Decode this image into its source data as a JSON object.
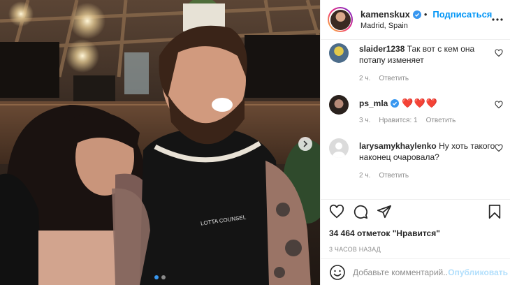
{
  "post": {
    "author": {
      "username": "kamenskux",
      "verified": true,
      "follow_label": "Подписаться",
      "location": "Madrid, Spain",
      "avatar_icon": "profile-avatar"
    },
    "photo": {
      "printed_text": "LOTTA COUNSEL",
      "carousel_dots": 2,
      "active_dot": 0,
      "next_icon": "chevron-right-icon"
    },
    "comments": [
      {
        "username": "slaider1238",
        "verified": false,
        "text": "Так вот с кем она потапу изменяет",
        "time": "2 ч.",
        "reply_label": "Ответить",
        "likes_label": "",
        "avatar_color": "#6d8e4f"
      },
      {
        "username": "ps_mla",
        "verified": true,
        "text": "❤️❤️❤️",
        "time": "3 ч.",
        "likes_label": "Нравится: 1",
        "reply_label": "Ответить",
        "avatar_color": "#4a3a33"
      },
      {
        "username": "larysamykhaylenko",
        "verified": false,
        "text": "Ну хоть такого наконец очаровала?",
        "time": "2 ч.",
        "reply_label": "Ответить",
        "likes_label": "",
        "avatar_color": "#dbdbdb"
      }
    ],
    "likes_text": "34 464 отметок \"Нравится\"",
    "posted_ago": "3 ЧАСОВ НАЗАД",
    "add_comment": {
      "placeholder": "Добавьте комментарий...",
      "publish_label": "Опубликовать"
    },
    "colors": {
      "accent": "#0095f6",
      "publish_disabled": "#b2dffc",
      "heart": "#ed4956",
      "muted": "#8e8e8e"
    }
  }
}
